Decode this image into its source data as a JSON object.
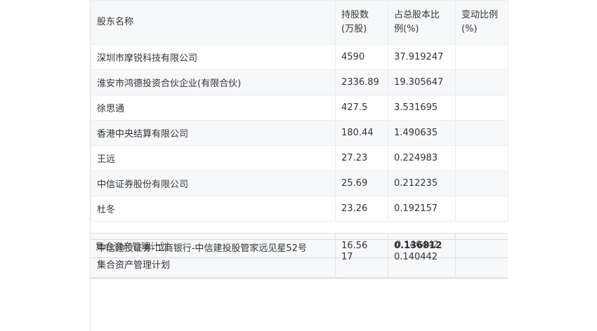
{
  "table": {
    "headers": {
      "name": "股东名称",
      "shares_l1": "持股数",
      "shares_l2": "(万股)",
      "pct_l1": "占总股本比",
      "pct_l2": "例(%)",
      "change_l1": "变动比例",
      "change_l2": "(%)"
    },
    "rows": [
      {
        "name": "深圳市摩锐科技有限公司",
        "shares": "4590",
        "pct": "37.919247",
        "change": ""
      },
      {
        "name": "淮安市鸿德投资合伙企业(有限合伙)",
        "shares": "2336.89",
        "pct": "19.305647",
        "change": ""
      },
      {
        "name": "徐思通",
        "shares": "427.5",
        "pct": "3.531695",
        "change": ""
      },
      {
        "name": "香港中央结算有限公司",
        "shares": "180.44",
        "pct": "1.490635",
        "change": ""
      },
      {
        "name": "王远",
        "shares": "27.23",
        "pct": "0.224983",
        "change": ""
      },
      {
        "name": "中信证券股份有限公司",
        "shares": "25.69",
        "pct": "0.212235",
        "change": ""
      },
      {
        "name": "杜冬",
        "shares": "23.26",
        "pct": "0.192157",
        "change": ""
      }
    ],
    "overlapped_rows": [
      {
        "name": "中信建投证券-工商银行-中信建投股管家远见星52号",
        "shares": "17",
        "pct": "0.140442"
      },
      {
        "name": "集合资产管理计划",
        "shares": "16.56",
        "pct": "0.136812"
      }
    ]
  }
}
